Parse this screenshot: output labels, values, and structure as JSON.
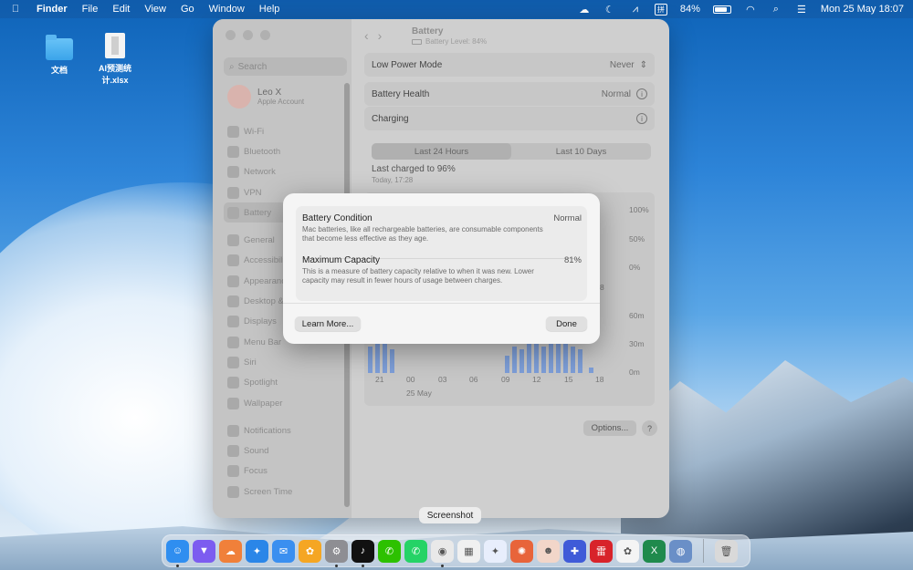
{
  "menubar": {
    "app_name": "Finder",
    "menus": [
      "File",
      "Edit",
      "View",
      "Go",
      "Window",
      "Help"
    ],
    "ime": "拼",
    "battery_percent": "84%",
    "datetime": "Mon 25 May  18:07"
  },
  "desktop": {
    "icons": [
      {
        "label": "文档",
        "icon": "folder-icon"
      },
      {
        "label": "AI预测统计.xlsx",
        "icon": "spreadsheet-file-icon"
      }
    ]
  },
  "settings": {
    "search_placeholder": "Search",
    "profile": {
      "name": "Leo X",
      "subtitle": "Apple Account"
    },
    "sidebar_items": [
      {
        "label": "Wi-Fi"
      },
      {
        "label": "Bluetooth"
      },
      {
        "label": "Network"
      },
      {
        "label": "VPN"
      },
      {
        "label": "Battery"
      },
      {
        "label": "General"
      },
      {
        "label": "Accessibility"
      },
      {
        "label": "Appearance"
      },
      {
        "label": "Desktop & Dock"
      },
      {
        "label": "Displays"
      },
      {
        "label": "Menu Bar"
      },
      {
        "label": "Siri"
      },
      {
        "label": "Spotlight"
      },
      {
        "label": "Wallpaper"
      },
      {
        "label": "Notifications"
      },
      {
        "label": "Sound"
      },
      {
        "label": "Focus"
      },
      {
        "label": "Screen Time"
      }
    ],
    "title": "Battery",
    "subtitle": "Battery Level: 84%",
    "low_power_mode": {
      "label": "Low Power Mode",
      "value": "Never"
    },
    "battery_health": {
      "label": "Battery Health",
      "value": "Normal"
    },
    "charging": {
      "label": "Charging"
    },
    "tabs": [
      "Last 24 Hours",
      "Last 10 Days"
    ],
    "last_charged": "Last charged to 96%",
    "last_charged_time": "Today, 17:28",
    "level_axis": [
      "100%",
      "50%",
      "0%"
    ],
    "usage_axis": [
      "60m",
      "30m",
      "0m"
    ],
    "x_ticks": [
      "21",
      "00",
      "03",
      "06",
      "09",
      "12",
      "15",
      "18"
    ],
    "date_label": "25 May",
    "side_fragment": "8",
    "options_label": "Options...",
    "help_label": "?"
  },
  "dialog": {
    "condition_label": "Battery Condition",
    "condition_value": "Normal",
    "condition_desc": "Mac batteries, like all rechargeable batteries, are consumable components that become less effective as they age.",
    "capacity_label": "Maximum Capacity",
    "capacity_value": "81%",
    "capacity_desc": "This is a measure of battery capacity relative to when it was new. Lower capacity may result in fewer hours of usage between charges.",
    "learn_more": "Learn More...",
    "done": "Done"
  },
  "tooltip": "Screenshot",
  "dock": {
    "apps": [
      {
        "name": "finder-icon",
        "color": "#2f8ef0",
        "glyph": "☺"
      },
      {
        "name": "vpn-app-icon",
        "color": "#7c5cf0",
        "glyph": "▼"
      },
      {
        "name": "cloud-app-icon",
        "color": "#f0803a",
        "glyph": "☁"
      },
      {
        "name": "safari-icon",
        "color": "#2a86e8",
        "glyph": "✦"
      },
      {
        "name": "mail-icon",
        "color": "#3a8ff0",
        "glyph": "✉"
      },
      {
        "name": "photos-icon",
        "color": "#f5a623",
        "glyph": "✿"
      },
      {
        "name": "system-settings-icon",
        "color": "#8e8e93",
        "glyph": "⚙"
      },
      {
        "name": "tiktok-icon",
        "color": "#111111",
        "glyph": "♪"
      },
      {
        "name": "wechat-icon",
        "color": "#2dc100",
        "glyph": "✆"
      },
      {
        "name": "whatsapp-icon",
        "color": "#25d366",
        "glyph": "✆"
      },
      {
        "name": "screenshot-icon",
        "color": "#e9e9e9",
        "glyph": "◉"
      },
      {
        "name": "launchpad-icon",
        "color": "#f0f0f0",
        "glyph": "▦"
      },
      {
        "name": "ai-assistant-icon",
        "color": "#e8eefc",
        "glyph": "✦"
      },
      {
        "name": "claude-icon",
        "color": "#e8643a",
        "glyph": "✺"
      },
      {
        "name": "avatar-app-icon",
        "color": "#f2d6c9",
        "glyph": "☻"
      },
      {
        "name": "blue-app-icon",
        "color": "#3f5bd8",
        "glyph": "✚"
      },
      {
        "name": "leishen-icon",
        "color": "#d8232a",
        "glyph": "雷"
      },
      {
        "name": "palette-app-icon",
        "color": "#f4f4f4",
        "glyph": "✿"
      },
      {
        "name": "excel-icon",
        "color": "#1f8a4c",
        "glyph": "X"
      },
      {
        "name": "disk-utility-icon",
        "color": "#6a8fc7",
        "glyph": "◍"
      },
      {
        "name": "trash-icon",
        "color": "#d9d9d9",
        "glyph": "🗑"
      }
    ]
  },
  "chart_data": {
    "type": "bar",
    "series": [
      {
        "values": [
          0.9,
          1.0,
          1.0,
          0.8,
          0.6,
          0.9,
          0.8,
          1.0,
          1.0,
          0.9,
          1.0,
          1.0,
          1.0,
          0.9,
          0.8,
          0.2
        ]
      }
    ],
    "ylabel_right": [
      "60m",
      "30m",
      "0m"
    ]
  }
}
